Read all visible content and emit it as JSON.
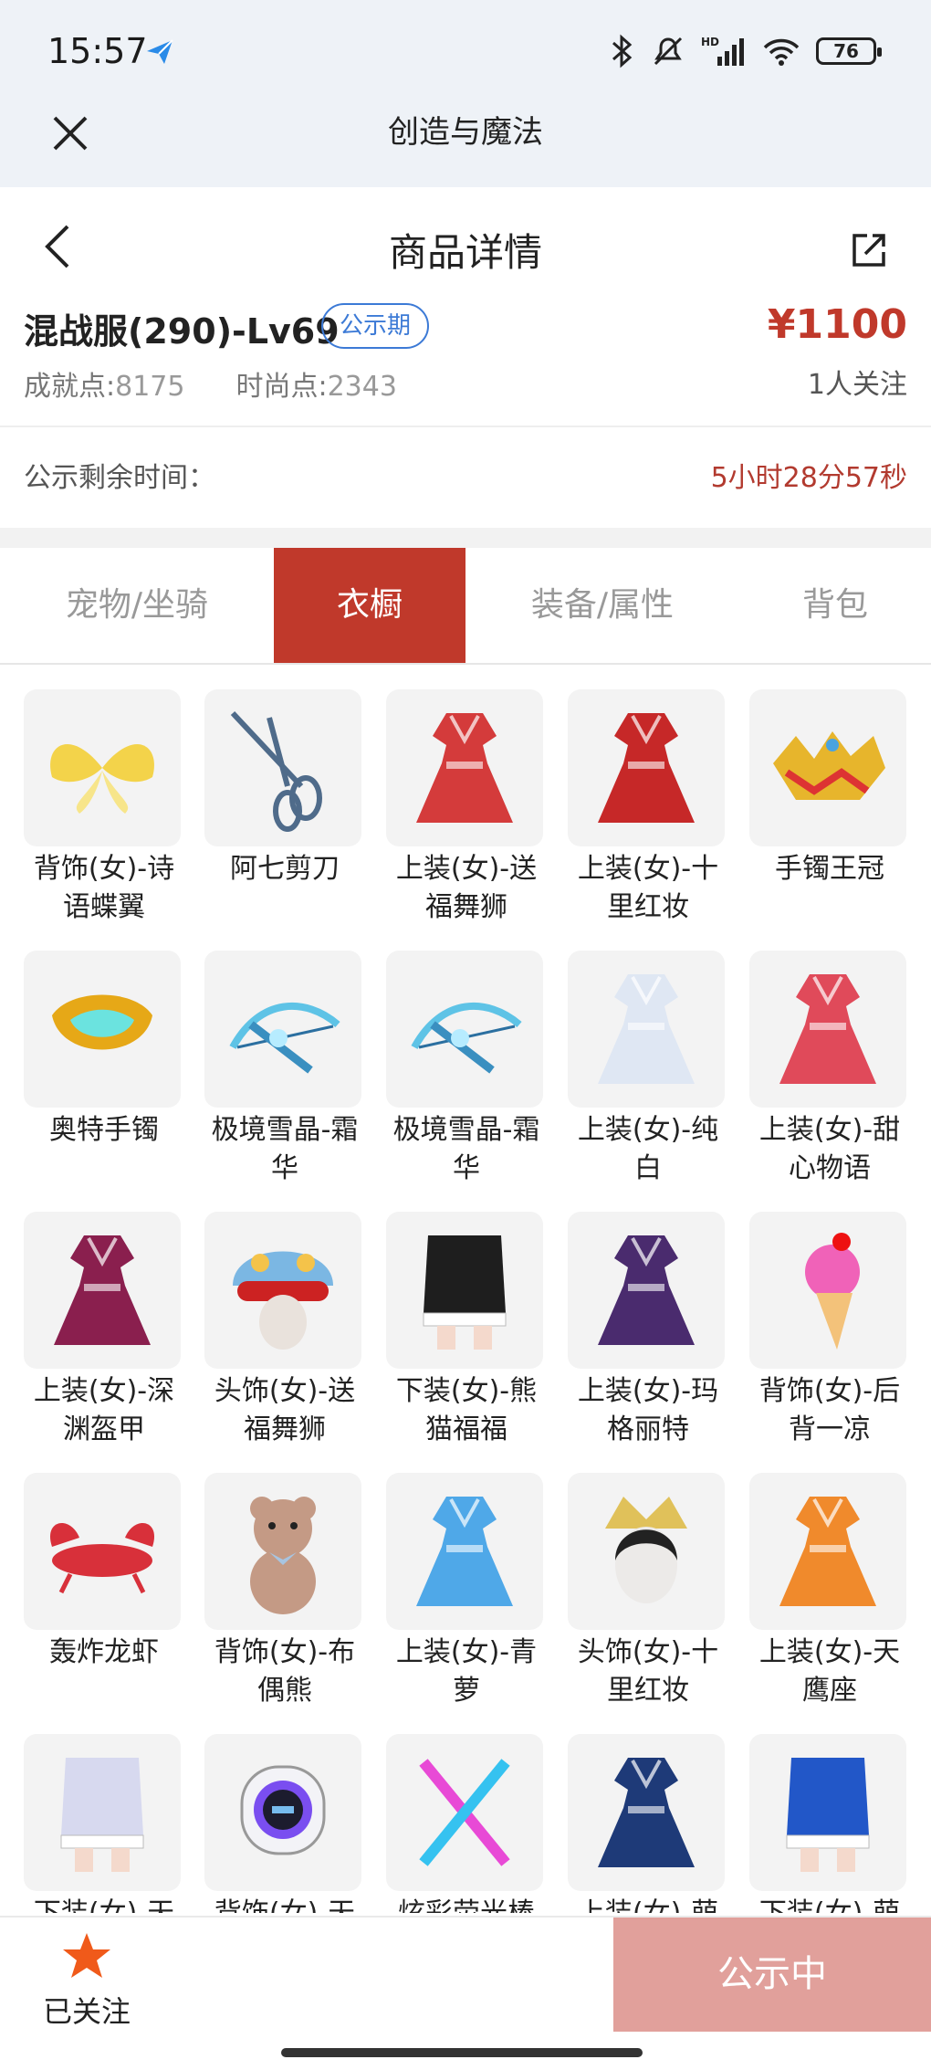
{
  "status_bar": {
    "time": "15:57",
    "battery": "76"
  },
  "app_bar": {
    "title": "创造与魔法"
  },
  "nav": {
    "title": "商品详情"
  },
  "product": {
    "name": "混战服(290)-Lv69",
    "badge": "公示期",
    "price": "¥1100",
    "achievement_label": "成就点:",
    "achievement_value": "8175",
    "fashion_label": "时尚点:",
    "fashion_value": "2343",
    "follow_count": "1人关注"
  },
  "notice": {
    "label": "公示剩余时间：",
    "remaining": "5小时28分57秒"
  },
  "tabs": [
    {
      "label": "宠物/坐骑",
      "active": false
    },
    {
      "label": "衣橱",
      "active": true
    },
    {
      "label": "装备/属性",
      "active": false
    },
    {
      "label": "背包",
      "active": false
    }
  ],
  "items": [
    {
      "label": "背饰(女)-诗语蝶翼",
      "icon": "butterfly-wings-icon",
      "color": "#f3d34a"
    },
    {
      "label": "阿七剪刀",
      "icon": "scissors-icon",
      "color": "#4f6b8a"
    },
    {
      "label": "上装(女)-送福舞狮",
      "icon": "lion-dance-outfit-icon",
      "color": "#d43b3b"
    },
    {
      "label": "上装(女)-十里红妆",
      "icon": "red-dress-icon",
      "color": "#c62828"
    },
    {
      "label": "手镯王冠",
      "icon": "crown-bracelet-icon",
      "color": "#e7b52c"
    },
    {
      "label": "奥特手镯",
      "icon": "gold-bracelet-icon",
      "color": "#e6a817"
    },
    {
      "label": "极境雪晶-霜华",
      "icon": "ice-crossbow-icon",
      "color": "#5ec3e6"
    },
    {
      "label": "极境雪晶-霜华",
      "icon": "ice-crossbow-icon",
      "color": "#5ec3e6"
    },
    {
      "label": "上装(女)-纯白",
      "icon": "white-dress-icon",
      "color": "#dfe7f3"
    },
    {
      "label": "上装(女)-甜心物语",
      "icon": "sweetheart-dress-icon",
      "color": "#e04a5a"
    },
    {
      "label": "上装(女)-深渊盔甲",
      "icon": "abyss-armor-icon",
      "color": "#8a1f4e"
    },
    {
      "label": "头饰(女)-送福舞狮",
      "icon": "lion-headpiece-icon",
      "color": "#7bb7e3"
    },
    {
      "label": "下装(女)-熊猫福福",
      "icon": "panda-skirt-icon",
      "color": "#1e1e1e"
    },
    {
      "label": "上装(女)-玛格丽特",
      "icon": "purple-gown-icon",
      "color": "#4a2b6e"
    },
    {
      "label": "背饰(女)-后背一凉",
      "icon": "ice-cream-icon",
      "color": "#f062b8"
    },
    {
      "label": "轰炸龙虾",
      "icon": "lobster-icon",
      "color": "#d8303a"
    },
    {
      "label": "背饰(女)-布偶熊",
      "icon": "teddy-bear-icon",
      "color": "#c49a85"
    },
    {
      "label": "上装(女)-青萝",
      "icon": "blue-dress-icon",
      "color": "#4fa8e8"
    },
    {
      "label": "头饰(女)-十里红妆",
      "icon": "bridal-headpiece-icon",
      "color": "#e0c15a"
    },
    {
      "label": "上装(女)-天鹰座",
      "icon": "aquila-jacket-icon",
      "color": "#f08a2c"
    },
    {
      "label": "下装(女)-天",
      "icon": "white-boots-icon",
      "color": "#d7d9ef"
    },
    {
      "label": "背饰(女)-天",
      "icon": "robot-backpack-icon",
      "color": "#7a4ef0"
    },
    {
      "label": "炫彩荧光棒",
      "icon": "glow-sticks-icon",
      "color": "#e84ad6"
    },
    {
      "label": "上装(女)-萌",
      "icon": "dark-blue-dress-icon",
      "color": "#1e3a78"
    },
    {
      "label": "下装(女)-萌",
      "icon": "blue-skirt-icon",
      "color": "#2257c8"
    }
  ],
  "bottom": {
    "followed_label": "已关注",
    "cta_label": "公示中"
  }
}
